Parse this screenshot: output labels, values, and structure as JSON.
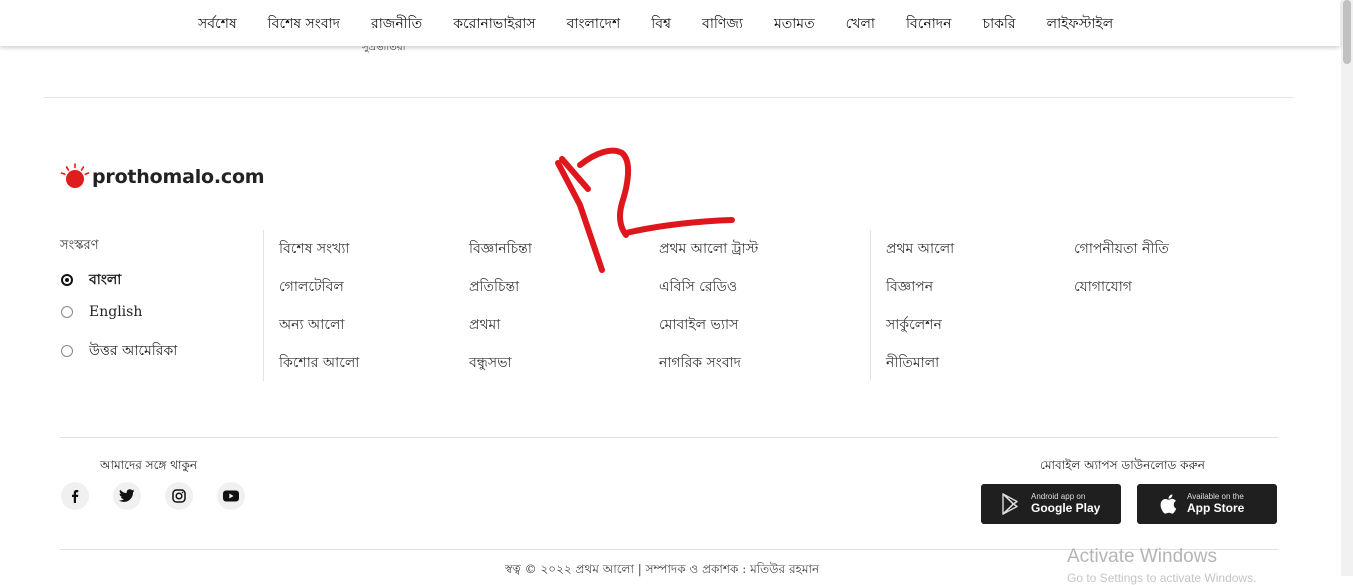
{
  "nav": {
    "items": [
      "সর্বশেষ",
      "বিশেষ সংবাদ",
      "রাজনীতি",
      "করোনাভাইরাস",
      "বাংলাদেশ",
      "বিশ্ব",
      "বাণিজ্য",
      "মতামত",
      "খেলা",
      "বিনোদন",
      "চাকরি",
      "লাইফস্টাইল"
    ]
  },
  "clipped_text": "সুপ্রভাতিয়া",
  "logo": {
    "text": "prothomalo.com",
    "accent_color": "#e21b1b"
  },
  "edition": {
    "title": "সংস্করণ",
    "options": [
      {
        "label": "বাংলা",
        "selected": true
      },
      {
        "label": "English",
        "selected": false
      },
      {
        "label": "উত্তর আমেরিকা",
        "selected": false
      }
    ]
  },
  "links": {
    "col1": [
      "বিশেষ সংখ্যা",
      "গোলটেবিল",
      "অন্য আলো",
      "কিশোর আলো"
    ],
    "col2": [
      "বিজ্ঞানচিন্তা",
      "প্রতিচিন্তা",
      "প্রথমা",
      "বন্ধুসভা"
    ],
    "col3": [
      "প্রথম আলো ট্রাস্ট",
      "এবিসি রেডিও",
      "মোবাইল ভ্যাস",
      "নাগরিক সংবাদ"
    ],
    "col4": [
      "প্রথম আলো",
      "বিজ্ঞাপন",
      "সার্কুলেশন",
      "নীতিমালা"
    ],
    "col5": [
      "গোপনীয়তা নীতি",
      "যোগাযোগ"
    ]
  },
  "social": {
    "title": "আমাদের সঙ্গে থাকুন",
    "icons": [
      "facebook-icon",
      "twitter-icon",
      "instagram-icon",
      "youtube-icon"
    ]
  },
  "apps": {
    "title": "মোবাইল অ্যাপস ডাউনলোড করুন",
    "google": {
      "small": "Android app on",
      "big": "Google Play"
    },
    "apple": {
      "small": "Available on the",
      "big": "App Store"
    }
  },
  "copyright": "স্বত্ব © ২০২২ প্রথম আলো | সম্পাদক ও প্রকাশক : মতিউর রহমান",
  "watermark": {
    "title": "Activate Windows",
    "subtitle": "Go to Settings to activate Windows."
  },
  "annotation": {
    "text": "12",
    "color": "#e0161d"
  }
}
